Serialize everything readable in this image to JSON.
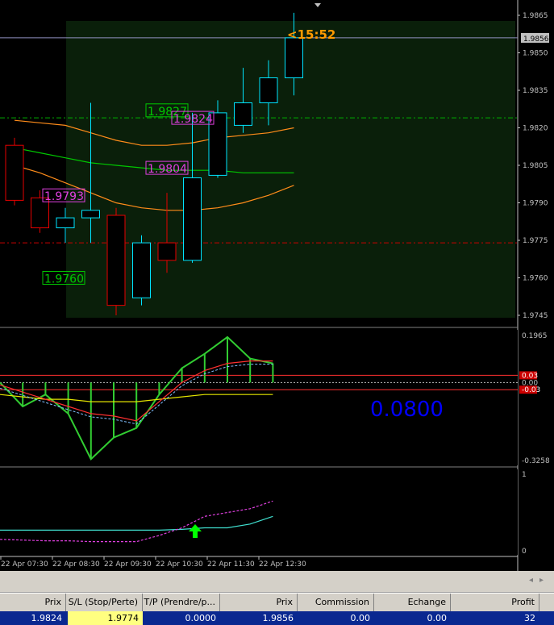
{
  "colors": {
    "background": "#000000",
    "chart_area": "#0a1f0a",
    "axis": "#c0c0c0",
    "candle_up": "#00e5ff",
    "candle_down": "#e60000",
    "bb_outer": "#ff8c1a",
    "bb_mid": "#00c800",
    "stop_line": "#cc0000",
    "take_line": "#00b000",
    "macd_hist": "#32cd32",
    "signal_red": "#ff3030",
    "ma_yellow": "#e6e600",
    "value_blue": "#0000ff",
    "timer_orange": "#ff9900",
    "stoch_main": "#40e0d0",
    "stoch_signal": "#e040e0",
    "arrow_green": "#00ff00"
  },
  "main_chart": {
    "timer_label": "<15:52",
    "current_price_tag": "1.9856",
    "price_axis": [
      "1.9865",
      "1.9850",
      "1.9835",
      "1.9820",
      "1.9805",
      "1.9790",
      "1.9775",
      "1.9760",
      "1.9745"
    ],
    "level_labels": [
      {
        "text": "1.9827",
        "color": "#00c800"
      },
      {
        "text": "1.9824",
        "color": "#e040e0"
      },
      {
        "text": "1.9804",
        "color": "#e040e0"
      },
      {
        "text": "1.9793",
        "color": "#e040e0"
      },
      {
        "text": "1.9760",
        "color": "#00c800"
      }
    ]
  },
  "chart_data": [
    {
      "type": "candlestick",
      "title": "",
      "ylim": [
        1.974,
        1.987
      ],
      "candles": [
        {
          "open": 1.9813,
          "high": 1.9816,
          "low": 1.9789,
          "close": 1.9791
        },
        {
          "open": 1.9792,
          "high": 1.9795,
          "low": 1.9778,
          "close": 1.978
        },
        {
          "open": 1.978,
          "high": 1.9788,
          "low": 1.9774,
          "close": 1.9784
        },
        {
          "open": 1.9784,
          "high": 1.983,
          "low": 1.9774,
          "close": 1.9787
        },
        {
          "open": 1.9785,
          "high": 1.9788,
          "low": 1.9745,
          "close": 1.9749
        },
        {
          "open": 1.9752,
          "high": 1.9777,
          "low": 1.9749,
          "close": 1.9774
        },
        {
          "open": 1.9774,
          "high": 1.9794,
          "low": 1.9762,
          "close": 1.9767
        },
        {
          "open": 1.9767,
          "high": 1.9826,
          "low": 1.9766,
          "close": 1.98
        },
        {
          "open": 1.9801,
          "high": 1.9831,
          "low": 1.98,
          "close": 1.9826
        },
        {
          "open": 1.9821,
          "high": 1.9844,
          "low": 1.9818,
          "close": 1.983
        },
        {
          "open": 1.983,
          "high": 1.9847,
          "low": 1.9821,
          "close": 1.984
        },
        {
          "open": 1.984,
          "high": 1.9866,
          "low": 1.9833,
          "close": 1.9856
        }
      ]
    },
    {
      "type": "line",
      "title": "",
      "y_axis_labels": [
        "0.1965",
        "0.03",
        "0.00",
        "-0.03",
        "-0.3258"
      ],
      "value_label": "0.0800",
      "histogram": [
        0.0,
        -0.1,
        -0.05,
        -0.13,
        -0.32,
        -0.23,
        -0.19,
        -0.05,
        0.06,
        0.12,
        0.19,
        0.1,
        0.08
      ],
      "signal": [
        -0.01,
        -0.04,
        -0.07,
        -0.1,
        -0.13,
        -0.14,
        -0.16,
        -0.08,
        0.0,
        0.05,
        0.08,
        0.09,
        0.09
      ],
      "ma": [
        -0.05,
        -0.06,
        -0.07,
        -0.07,
        -0.08,
        -0.08,
        -0.08,
        -0.07,
        -0.06,
        -0.05,
        -0.05,
        -0.05,
        -0.05
      ]
    },
    {
      "type": "line",
      "title": "",
      "y_axis_labels": [
        "1",
        "0"
      ],
      "main": [
        0.27,
        0.27,
        0.27,
        0.27,
        0.27,
        0.27,
        0.27,
        0.27,
        0.28,
        0.3,
        0.3,
        0.35,
        0.45
      ],
      "signal": [
        0.15,
        0.14,
        0.13,
        0.13,
        0.12,
        0.12,
        0.12,
        0.2,
        0.3,
        0.45,
        0.5,
        0.55,
        0.65
      ]
    }
  ],
  "time_axis": [
    "22 Apr 07:30",
    "22 Apr 08:30",
    "22 Apr 09:30",
    "22 Apr 10:30",
    "22 Apr 11:30",
    "22 Apr 12:30"
  ],
  "terminal": {
    "columns": [
      "Prix",
      "S/L (Stop/Perte)",
      "T/P (Prendre/p...",
      "Prix",
      "Commission",
      "Echange",
      "Profit"
    ],
    "row": {
      "price": "1.9824",
      "sl": "1.9774",
      "tp": "0.0000",
      "current": "1.9856",
      "commission": "0.00",
      "swap": "0.00",
      "profit": "32"
    }
  }
}
